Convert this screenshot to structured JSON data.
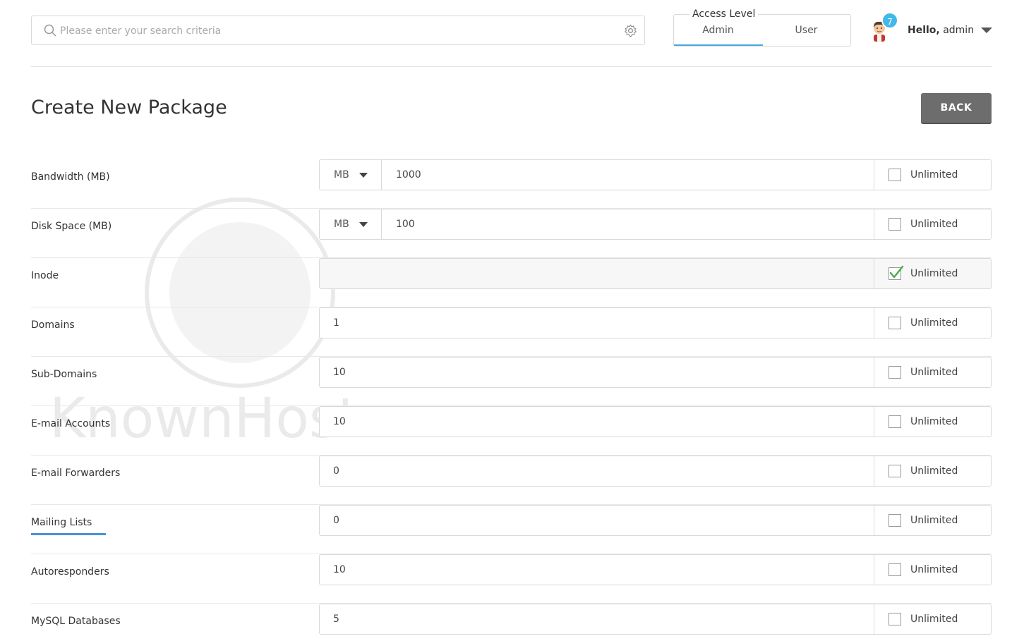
{
  "search": {
    "placeholder": "Please enter your search criteria"
  },
  "access_level": {
    "title": "Access Level",
    "options": [
      "Admin",
      "User"
    ],
    "selected": "Admin"
  },
  "notifications": {
    "count": "7"
  },
  "user": {
    "greeting": "Hello,",
    "name": "admin"
  },
  "page": {
    "title": "Create New Package",
    "back_label": "BACK"
  },
  "rows": [
    {
      "label": "Bandwidth (MB)",
      "unit": "MB",
      "value": "1000",
      "unlimited_label": "Unlimited",
      "unlimited": false
    },
    {
      "label": "Disk Space (MB)",
      "unit": "MB",
      "value": "100",
      "unlimited_label": "Unlimited",
      "unlimited": false
    },
    {
      "label": "Inode",
      "value": "",
      "unlimited_label": "Unlimited",
      "unlimited": true
    },
    {
      "label": "Domains",
      "value": "1",
      "unlimited_label": "Unlimited",
      "unlimited": false
    },
    {
      "label": "Sub-Domains",
      "value": "10",
      "unlimited_label": "Unlimited",
      "unlimited": false
    },
    {
      "label": "E-mail Accounts",
      "value": "10",
      "unlimited_label": "Unlimited",
      "unlimited": false
    },
    {
      "label": "E-mail Forwarders",
      "value": "0",
      "unlimited_label": "Unlimited",
      "unlimited": false
    },
    {
      "label": "Mailing Lists",
      "value": "0",
      "unlimited_label": "Unlimited",
      "unlimited": false
    },
    {
      "label": "Autoresponders",
      "value": "10",
      "unlimited_label": "Unlimited",
      "unlimited": false
    },
    {
      "label": "MySQL Databases",
      "value": "5",
      "unlimited_label": "Unlimited",
      "unlimited": false
    }
  ],
  "watermark": {
    "text": "KnownHost"
  },
  "colors": {
    "accent": "#43a9dc",
    "badge": "#42b8e8",
    "back_button": "#6d6d6d",
    "check": "#4caf50",
    "highlight": "#4a90d9"
  }
}
